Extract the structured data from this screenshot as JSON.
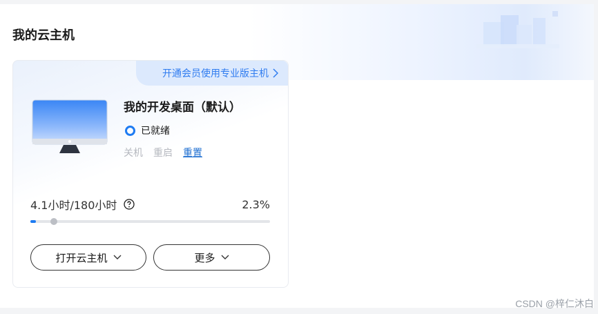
{
  "section": {
    "title": "我的云主机"
  },
  "card": {
    "member_banner": "开通会员使用专业版主机",
    "desktop_name": "我的开发桌面（默认）",
    "status": "已就绪",
    "actions": {
      "shutdown": "关机",
      "restart": "重启",
      "reset": "重置"
    },
    "usage": {
      "label": "4.1小时/180小时",
      "percent_text": "2.3%",
      "percent": 2.3
    },
    "buttons": {
      "open": "打开云主机",
      "more": "更多"
    }
  },
  "watermark": "CSDN @梓仁沐白",
  "colors": {
    "accent": "#1e7bf2",
    "link": "#1f6fd1",
    "disabled": "#b6b9c0"
  },
  "icons": {
    "help": "question-circle-icon",
    "chevron": "chevron-right-icon",
    "dropdown": "chevron-down-icon",
    "monitor": "monitor-icon"
  }
}
